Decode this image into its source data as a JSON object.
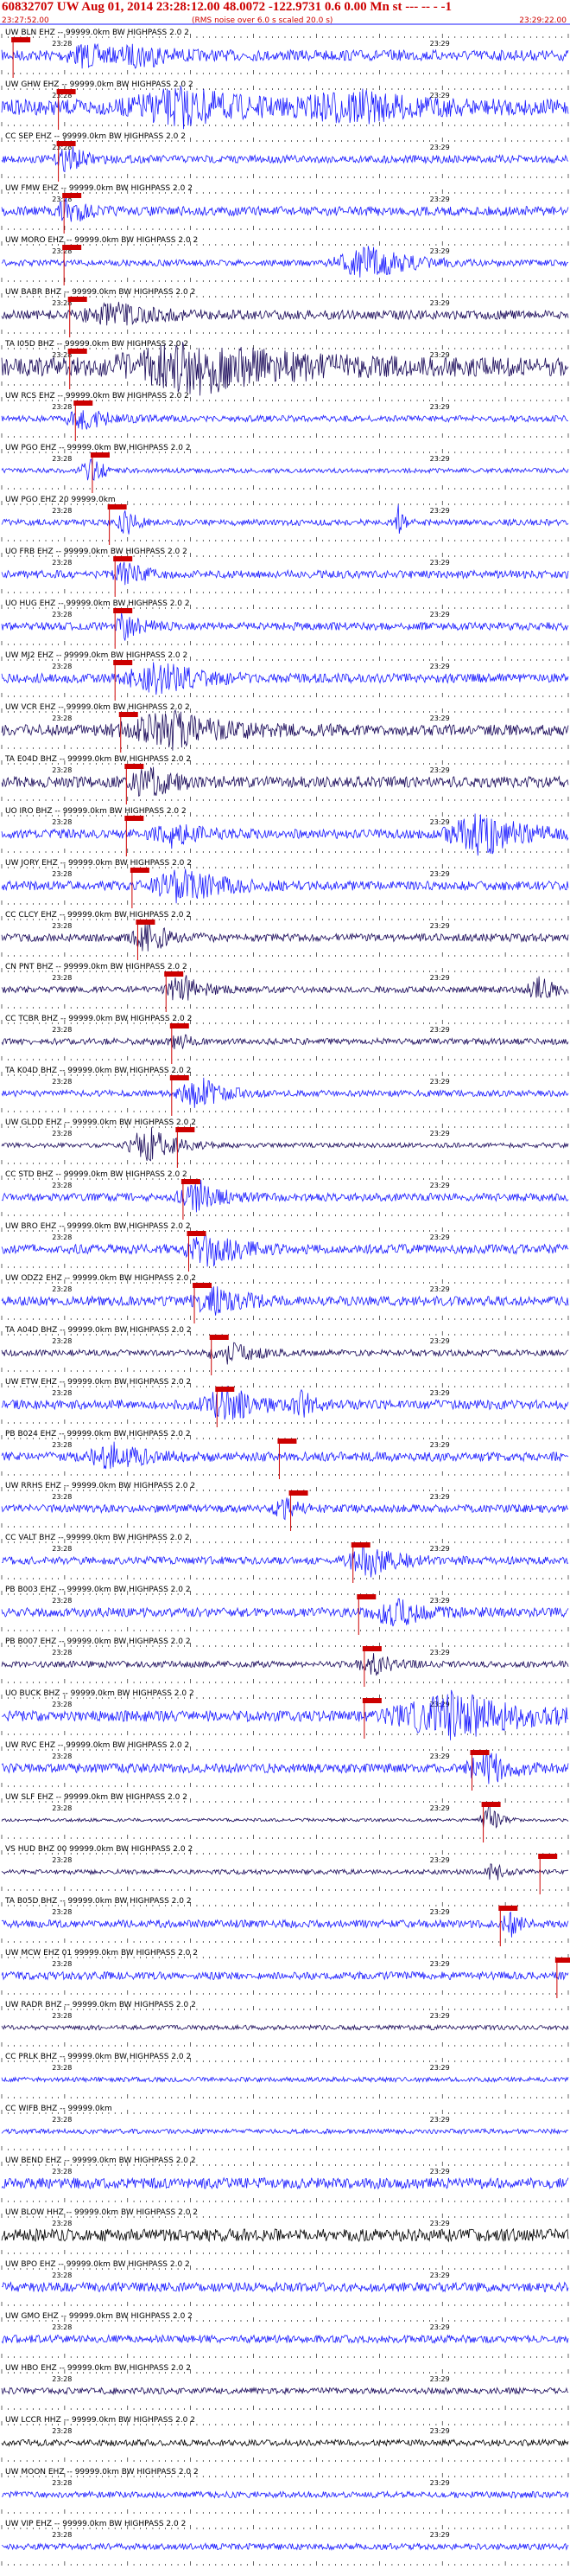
{
  "header": {
    "title": "60832707 UW Aug 01, 2014 23:28:12.00   48.0072 -122.9731  0.6 0.00 Mn st --- -- -  -1",
    "start_time": "23:27:52.00",
    "note": "(RMS noise over 6.0 s scaled 20.0 s)",
    "end_time": "23:29:22.00"
  },
  "chart_data": {
    "type": "seismogram",
    "time_ticks": [
      "23:28",
      "23:29"
    ],
    "colors": {
      "blue": "#1a1aff",
      "navy": "#1a0a5a",
      "black": "#000000",
      "pick": "#cc0000"
    },
    "traces": [
      {
        "label": "UW BLN EHZ -- 99999.0km BW  HIGHPASS  2.0  2",
        "color": "blue",
        "pick": 0.02,
        "amp": 0.35,
        "bursts": [
          [
            0.15,
            0.05,
            0.6
          ],
          [
            0.25,
            0.05,
            0.6
          ]
        ],
        "line": 1
      },
      {
        "label": "UW GHW EHZ -- 99999.0km BW  HIGHPASS  2.0  2",
        "color": "blue",
        "pick": 0.1,
        "amp": 0.5,
        "bursts": [
          [
            0.32,
            0.12,
            1.0
          ],
          [
            0.62,
            0.12,
            0.8
          ]
        ]
      },
      {
        "label": "CC SEP EHZ -- 99999.0km BW  HIGHPASS  2.0  2",
        "color": "blue",
        "pick": 0.1,
        "amp": 0.25,
        "bursts": [
          [
            0.12,
            0.03,
            0.8
          ]
        ]
      },
      {
        "label": "UW FMW EHZ -- 99999.0km BW  HIGHPASS  2.0  2",
        "color": "blue",
        "pick": 0.11,
        "amp": 0.3,
        "bursts": [
          [
            0.12,
            0.03,
            0.9
          ]
        ]
      },
      {
        "label": "UW MORO EHZ -- 99999.0km BW  HIGHPASS  2.0  2",
        "color": "blue",
        "pick": 0.11,
        "amp": 0.2,
        "bursts": [
          [
            0.65,
            0.08,
            1.0
          ]
        ]
      },
      {
        "label": "UW BABR BHZ -- 99999.0km BW  HIGHPASS  2.0  2",
        "color": "navy",
        "pick": 0.12,
        "amp": 0.3,
        "bursts": [
          [
            0.2,
            0.08,
            0.6
          ]
        ]
      },
      {
        "label": "TA I05D BHZ -- 99999.0km BW  HIGHPASS  2.0  2",
        "color": "navy",
        "pick": 0.12,
        "amp": 0.6,
        "bursts": [
          [
            0.35,
            0.18,
            1.3
          ]
        ]
      },
      {
        "label": "UW RCS EHZ -- 99999.0km BW  HIGHPASS  2.0  2",
        "color": "blue",
        "pick": 0.13,
        "amp": 0.2,
        "bursts": [
          [
            0.15,
            0.05,
            0.6
          ]
        ]
      },
      {
        "label": "UW PGO EHZ -- 99999.0km BW  HIGHPASS  2.0  2",
        "color": "blue",
        "pick": 0.16,
        "amp": 0.15,
        "bursts": [
          [
            0.16,
            0.03,
            0.7
          ]
        ]
      },
      {
        "label": "UW PGO EHZ 20 99999.0km",
        "color": "blue",
        "pick": 0.19,
        "amp": 0.2,
        "bursts": [
          [
            0.22,
            0.02,
            0.9
          ],
          [
            0.7,
            0.01,
            1.0
          ]
        ]
      },
      {
        "label": "UO FRB EHZ -- 99999.0km BW  HIGHPASS  2.0  2",
        "color": "blue",
        "pick": 0.2,
        "amp": 0.25,
        "bursts": [
          [
            0.22,
            0.03,
            1.0
          ]
        ]
      },
      {
        "label": "UO HUG EHZ -- 99999.0km BW  HIGHPASS  2.0  2",
        "color": "blue",
        "pick": 0.2,
        "amp": 0.25,
        "bursts": [
          [
            0.22,
            0.03,
            1.0
          ]
        ]
      },
      {
        "label": "UW MJ2 EHZ -- 99999.0km BW  HIGHPASS  2.0  2",
        "color": "blue",
        "pick": 0.2,
        "amp": 0.3,
        "bursts": [
          [
            0.28,
            0.08,
            0.9
          ]
        ]
      },
      {
        "label": "UW VCR EHZ -- 99999.0km BW  HIGHPASS  2.0  2",
        "color": "navy",
        "pick": 0.21,
        "amp": 0.35,
        "bursts": [
          [
            0.3,
            0.12,
            1.0
          ]
        ]
      },
      {
        "label": "TA E04D BHZ -- 99999.0km BW  HIGHPASS  2.0  2",
        "color": "navy",
        "pick": 0.22,
        "amp": 0.35,
        "bursts": [
          [
            0.26,
            0.05,
            0.9
          ]
        ]
      },
      {
        "label": "UO IRO BHZ -- 99999.0km BW  HIGHPASS  2.0  2",
        "color": "blue",
        "pick": 0.22,
        "amp": 0.3,
        "bursts": [
          [
            0.3,
            0.05,
            0.7
          ],
          [
            0.85,
            0.08,
            1.3
          ]
        ]
      },
      {
        "label": "UW JORY EHZ -- 99999.0km BW  HIGHPASS  2.0  2",
        "color": "blue",
        "pick": 0.23,
        "amp": 0.3,
        "bursts": [
          [
            0.32,
            0.08,
            1.0
          ]
        ]
      },
      {
        "label": "CC CLCY EHZ -- 99999.0km BW  HIGHPASS  2.0  2",
        "color": "navy",
        "pick": 0.24,
        "amp": 0.25,
        "bursts": [
          [
            0.26,
            0.04,
            0.9
          ]
        ]
      },
      {
        "label": "CN PNT BHZ -- 99999.0km BW  HIGHPASS  2.0  2",
        "color": "navy",
        "pick": 0.29,
        "amp": 0.2,
        "bursts": [
          [
            0.32,
            0.04,
            0.9
          ],
          [
            0.95,
            0.03,
            0.8
          ]
        ]
      },
      {
        "label": "CC TCBR BHZ -- 99999.0km BW  HIGHPASS  2.0  2",
        "color": "navy",
        "pick": 0.3,
        "amp": 0.2,
        "bursts": [
          [
            0.31,
            0.02,
            0.6
          ]
        ]
      },
      {
        "label": "TA K04D BHZ -- 99999.0km BW  HIGHPASS  2.0  2",
        "color": "blue",
        "pick": 0.3,
        "amp": 0.2,
        "bursts": [
          [
            0.35,
            0.05,
            1.0
          ]
        ]
      },
      {
        "label": "UW GLDD EHZ -- 99999.0km BW  HIGHPASS  2.0  2",
        "color": "navy",
        "pick": 0.31,
        "amp": 0.15,
        "bursts": [
          [
            0.26,
            0.05,
            1.2
          ]
        ]
      },
      {
        "label": "CC STD BHZ -- 99999.0km BW  HIGHPASS  2.0  2",
        "color": "blue",
        "pick": 0.32,
        "amp": 0.25,
        "bursts": [
          [
            0.35,
            0.05,
            0.9
          ]
        ]
      },
      {
        "label": "UW BRO EHZ -- 99999.0km BW  HIGHPASS  2.0  2",
        "color": "blue",
        "pick": 0.33,
        "amp": 0.3,
        "bursts": [
          [
            0.37,
            0.06,
            1.0
          ]
        ]
      },
      {
        "label": "UW ODZ2 EHZ -- 99999.0km BW  HIGHPASS  2.0  2",
        "color": "blue",
        "pick": 0.34,
        "amp": 0.3,
        "bursts": [
          [
            0.38,
            0.06,
            0.8
          ]
        ]
      },
      {
        "label": "TA A04D BHZ -- 99999.0km BW  HIGHPASS  2.0  2",
        "color": "navy",
        "pick": 0.37,
        "amp": 0.2,
        "bursts": [
          [
            0.4,
            0.05,
            0.7
          ]
        ]
      },
      {
        "label": "UW ETW EHZ -- 99999.0km BW  HIGHPASS  2.0  2",
        "color": "blue",
        "pick": 0.38,
        "amp": 0.3,
        "bursts": [
          [
            0.4,
            0.06,
            1.0
          ],
          [
            0.53,
            0.02,
            0.9
          ]
        ]
      },
      {
        "label": "PB B024 EHZ -- 99999.0km BW  HIGHPASS  2.0  2",
        "color": "blue",
        "pick": 0.49,
        "amp": 0.3,
        "bursts": [
          [
            0.2,
            0.06,
            0.7
          ]
        ]
      },
      {
        "label": "UW RRHS EHZ -- 99999.0km BW  HIGHPASS  2.0  2",
        "color": "blue",
        "pick": 0.51,
        "amp": 0.25,
        "bursts": [
          [
            0.5,
            0.03,
            0.6
          ]
        ]
      },
      {
        "label": "CC VALT BHZ -- 99999.0km BW  HIGHPASS  2.0  2",
        "color": "blue",
        "pick": 0.62,
        "amp": 0.25,
        "bursts": [
          [
            0.65,
            0.06,
            0.9
          ]
        ]
      },
      {
        "label": "PB B003 EHZ -- 99999.0km BW  HIGHPASS  2.0  2",
        "color": "blue",
        "pick": 0.63,
        "amp": 0.3,
        "bursts": [
          [
            0.7,
            0.06,
            0.8
          ]
        ]
      },
      {
        "label": "PB B007 EHZ -- 99999.0km BW  HIGHPASS  2.0  2",
        "color": "navy",
        "pick": 0.64,
        "amp": 0.2,
        "bursts": [
          [
            0.66,
            0.04,
            0.6
          ]
        ]
      },
      {
        "label": "UO BUCK BHZ -- 99999.0km BW  HIGHPASS  2.0  2",
        "color": "blue",
        "pick": 0.64,
        "amp": 0.35,
        "bursts": [
          [
            0.8,
            0.14,
            1.4
          ]
        ]
      },
      {
        "label": "UW RVC EHZ -- 99999.0km BW  HIGHPASS  2.0  2",
        "color": "blue",
        "pick": 0.83,
        "amp": 0.3,
        "bursts": [
          [
            0.86,
            0.05,
            1.0
          ]
        ]
      },
      {
        "label": "UW SLF EHZ -- 99999.0km BW  HIGHPASS  2.0  2",
        "color": "navy",
        "pick": 0.85,
        "amp": 0.1,
        "bursts": [
          [
            0.86,
            0.02,
            1.0
          ]
        ]
      },
      {
        "label": "VS HUD BHZ 00 99999.0km BW  HIGHPASS  2.0  2",
        "color": "navy",
        "pick": 0.95,
        "amp": 0.15,
        "bursts": [
          [
            0.87,
            0.02,
            0.6
          ]
        ]
      },
      {
        "label": "TA B05D BHZ -- 99999.0km BW  HIGHPASS  2.0  2",
        "color": "blue",
        "pick": 0.88,
        "amp": 0.25,
        "bursts": [
          [
            0.9,
            0.02,
            0.8
          ]
        ]
      },
      {
        "label": "UW MCW EHZ 01 99999.0km BW  HIGHPASS  2.0  2",
        "color": "blue",
        "pick": 0.98,
        "amp": 0.25,
        "bursts": []
      },
      {
        "label": "UW RADR BHZ -- 99999.0km BW  HIGHPASS  2.0  2",
        "color": "navy",
        "pick": -1,
        "amp": 0.15,
        "bursts": []
      },
      {
        "label": "CC PRLK BHZ -- 99999.0km BW  HIGHPASS  2.0  2",
        "color": "blue",
        "pick": -1,
        "amp": 0.15,
        "bursts": []
      },
      {
        "label": "CC WIFB BHZ -- 99999.0km",
        "color": "blue",
        "pick": -1,
        "amp": 0.15,
        "bursts": []
      },
      {
        "label": "UW BEND EHZ -- 99999.0km BW  HIGHPASS  2.0  2",
        "color": "blue",
        "pick": -1,
        "amp": 0.35,
        "bursts": []
      },
      {
        "label": "UW BLOW HHZ -- 99999.0km BW  HIGHPASS  2.0  2",
        "color": "black",
        "pick": -1,
        "amp": 0.4,
        "bursts": []
      },
      {
        "label": "UW BPO EHZ -- 99999.0km BW  HIGHPASS  2.0  2",
        "color": "blue",
        "pick": -1,
        "amp": 0.3,
        "bursts": []
      },
      {
        "label": "UW GMO EHZ -- 99999.0km BW  HIGHPASS  2.0  2",
        "color": "blue",
        "pick": -1,
        "amp": 0.25,
        "bursts": []
      },
      {
        "label": "UW HBO EHZ -- 99999.0km BW  HIGHPASS  2.0  2",
        "color": "navy",
        "pick": -1,
        "amp": 0.2,
        "bursts": []
      },
      {
        "label": "UW LCCR HHZ -- 99999.0km BW  HIGHPASS  2.0  2",
        "color": "black",
        "pick": -1,
        "amp": 0.2,
        "bursts": []
      },
      {
        "label": "UW MOON EHZ -- 99999.0km BW  HIGHPASS  2.0  2",
        "color": "blue",
        "pick": -1,
        "amp": 0.2,
        "bursts": []
      },
      {
        "label": "UW VIP EHZ -- 99999.0km BW  HIGHPASS  2.0  2",
        "color": "blue",
        "pick": -1,
        "amp": 0.2,
        "bursts": []
      }
    ]
  }
}
